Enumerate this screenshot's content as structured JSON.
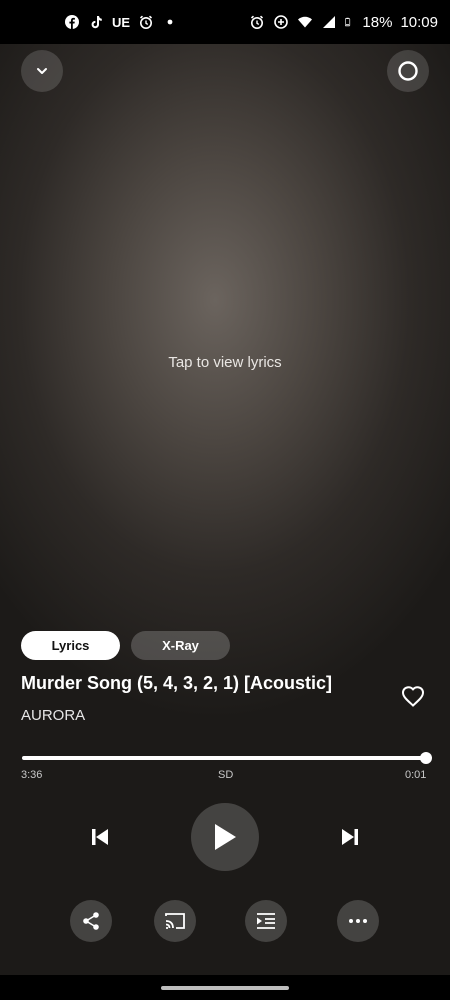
{
  "status_bar": {
    "left_icons": [
      "facebook-icon",
      "tiktok-icon",
      "ue-icon",
      "alarm-icon",
      "dot-icon"
    ],
    "ue_label": "UE",
    "right_icons": [
      "alarm-icon",
      "data-saver-icon",
      "wifi-icon",
      "signal-icon",
      "battery-icon"
    ],
    "battery": "18%",
    "time": "10:09"
  },
  "top_bar": {
    "collapse_icon": "chevron-down-icon",
    "alexa_icon": "alexa-ring-icon"
  },
  "lyrics_prompt": "Tap to view lyrics",
  "tabs": [
    {
      "label": "Lyrics",
      "active": true
    },
    {
      "label": "X-Ray",
      "active": false
    }
  ],
  "track": {
    "title": "Murder Song (5, 4, 3, 2, 1) [Acoustic]",
    "artist": "AURORA",
    "favorite_icon": "heart-outline-icon"
  },
  "playback": {
    "elapsed": "3:36",
    "quality": "SD",
    "remaining": "0:01",
    "progress": 0.99
  },
  "controls": {
    "previous": "skip-previous-icon",
    "play": "play-icon",
    "next": "skip-next-icon"
  },
  "actions": [
    {
      "icon": "share-icon"
    },
    {
      "icon": "cast-icon"
    },
    {
      "icon": "queue-icon"
    },
    {
      "icon": "more-icon"
    }
  ],
  "colors": {
    "background": "#2e2a27",
    "accent": "#ffffff"
  }
}
